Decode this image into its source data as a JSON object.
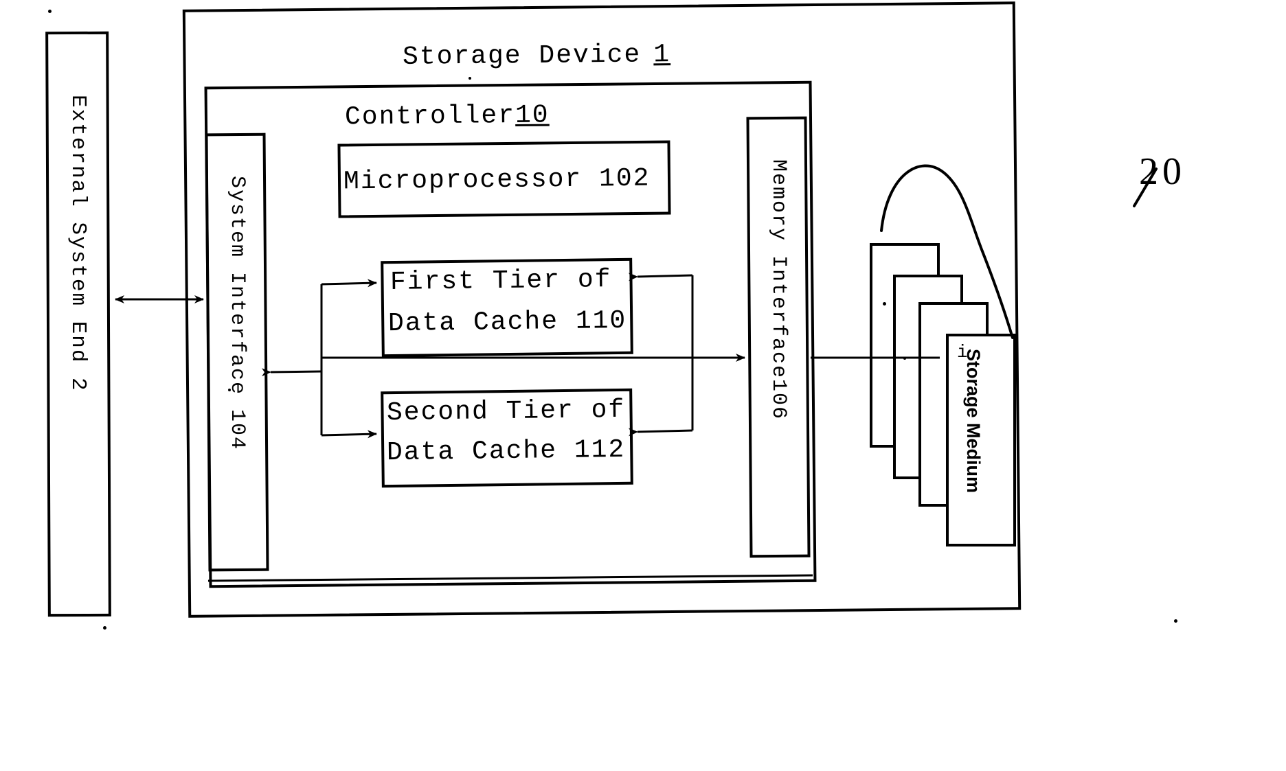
{
  "figure": {
    "type": "patent-block-diagram",
    "background_color": "#ffffff",
    "line_color": "#000000"
  },
  "outer": {
    "title": "Storage Device",
    "ref": "1"
  },
  "controller": {
    "title": "Controller",
    "ref": "10"
  },
  "external_system": {
    "label": "External System End 2"
  },
  "system_interface": {
    "label": "System Interface 104"
  },
  "memory_interface": {
    "label": "Memory Interface106"
  },
  "microprocessor": {
    "label": "Microprocessor 102"
  },
  "first_tier_cache": {
    "line1": "First Tier of",
    "line2": "Data Cache 110"
  },
  "second_tier_cache": {
    "line1": "Second Tier of",
    "line2": "Data Cache 112"
  },
  "storage_medium": {
    "label": "Storage Medium",
    "ref": "20",
    "stack_count": "4"
  }
}
